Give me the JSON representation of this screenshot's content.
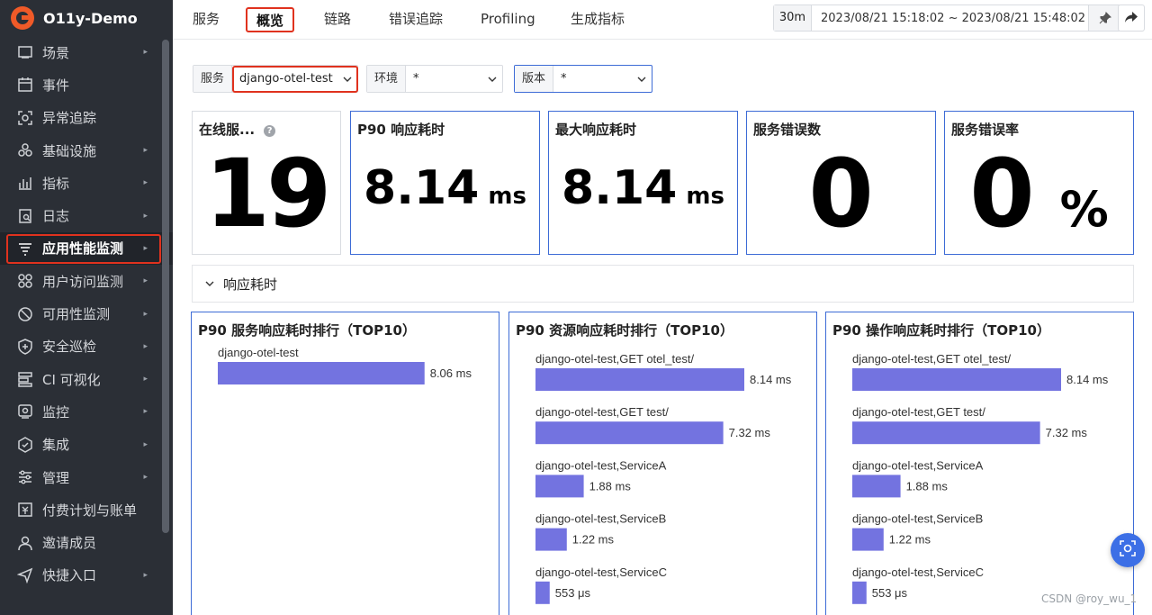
{
  "app": {
    "name": "O11y-Demo"
  },
  "sidebar": {
    "items": [
      {
        "label": "场景",
        "icon": "scene-icon",
        "has_arrow": true
      },
      {
        "label": "事件",
        "icon": "calendar-icon",
        "has_arrow": false
      },
      {
        "label": "异常追踪",
        "icon": "issue-tracking-icon",
        "has_arrow": false
      },
      {
        "label": "基础设施",
        "icon": "infrastructure-icon",
        "has_arrow": true
      },
      {
        "label": "指标",
        "icon": "metrics-icon",
        "has_arrow": true
      },
      {
        "label": "日志",
        "icon": "log-icon",
        "has_arrow": true
      },
      {
        "label": "应用性能监测",
        "icon": "apm-icon",
        "has_arrow": true,
        "active": true
      },
      {
        "label": "用户访问监测",
        "icon": "rum-icon",
        "has_arrow": true
      },
      {
        "label": "可用性监测",
        "icon": "availability-icon",
        "has_arrow": true
      },
      {
        "label": "安全巡检",
        "icon": "security-icon",
        "has_arrow": true
      },
      {
        "label": "CI 可视化",
        "icon": "ci-icon",
        "has_arrow": true
      },
      {
        "label": "监控",
        "icon": "monitor-icon",
        "has_arrow": true
      },
      {
        "label": "集成",
        "icon": "integration-icon",
        "has_arrow": true
      },
      {
        "label": "管理",
        "icon": "settings-icon",
        "has_arrow": true
      },
      {
        "label": "付费计划与账单",
        "icon": "billing-icon",
        "has_arrow": false
      },
      {
        "label": "邀请成员",
        "icon": "invite-user-icon",
        "has_arrow": false
      },
      {
        "label": "快捷入口",
        "icon": "shortcut-icon",
        "has_arrow": true
      }
    ]
  },
  "topbar": {
    "tabs": [
      {
        "label": "服务"
      },
      {
        "label": "概览",
        "active": true
      },
      {
        "label": "链路"
      },
      {
        "label": "错误追踪"
      },
      {
        "label": "Profiling"
      },
      {
        "label": "生成指标"
      }
    ],
    "time_quick": "30m",
    "time_range": "2023/08/21 15:18:02 ~ 2023/08/21 15:48:02"
  },
  "filters": {
    "service": {
      "label": "服务",
      "value": "django-otel-test"
    },
    "env": {
      "label": "环境",
      "value": "*"
    },
    "version": {
      "label": "版本",
      "value": "*"
    }
  },
  "stats": {
    "online": {
      "title": "在线服...",
      "value": "19"
    },
    "p90": {
      "title": "P90 响应耗时",
      "value": "8.14",
      "unit": "ms"
    },
    "max": {
      "title": "最大响应耗时",
      "value": "8.14",
      "unit": "ms"
    },
    "errors": {
      "title": "服务错误数",
      "value": "0"
    },
    "error_rate": {
      "title": "服务错误率",
      "value": "0",
      "unit": "%"
    }
  },
  "section": {
    "title": "响应耗时"
  },
  "colors": {
    "bar": "#7373e0",
    "accent": "#3d6bd6",
    "highlight": "#e0321e"
  },
  "chart_data": [
    {
      "type": "bar",
      "title": "P90 服务响应耗时排行（TOP10）",
      "categories": [
        "django-otel-test"
      ],
      "values": [
        8.06
      ],
      "value_labels": [
        "8.06 ms"
      ],
      "unit": "ms"
    },
    {
      "type": "bar",
      "title": "P90 资源响应耗时排行（TOP10）",
      "categories": [
        "django-otel-test,GET otel_test/",
        "django-otel-test,GET test/",
        "django-otel-test,ServiceA",
        "django-otel-test,ServiceB",
        "django-otel-test,ServiceC"
      ],
      "values": [
        8.14,
        7.32,
        1.88,
        1.22,
        0.553
      ],
      "value_labels": [
        "8.14 ms",
        "7.32 ms",
        "1.88 ms",
        "1.22 ms",
        "553 μs"
      ],
      "unit": "ms"
    },
    {
      "type": "bar",
      "title": "P90 操作响应耗时排行（TOP10）",
      "categories": [
        "django-otel-test,GET otel_test/",
        "django-otel-test,GET test/",
        "django-otel-test,ServiceA",
        "django-otel-test,ServiceB",
        "django-otel-test,ServiceC"
      ],
      "values": [
        8.14,
        7.32,
        1.88,
        1.22,
        0.553
      ],
      "value_labels": [
        "8.14 ms",
        "7.32 ms",
        "1.88 ms",
        "1.22 ms",
        "553 μs"
      ],
      "unit": "ms"
    }
  ],
  "watermark": "CSDN @roy_wu_1"
}
